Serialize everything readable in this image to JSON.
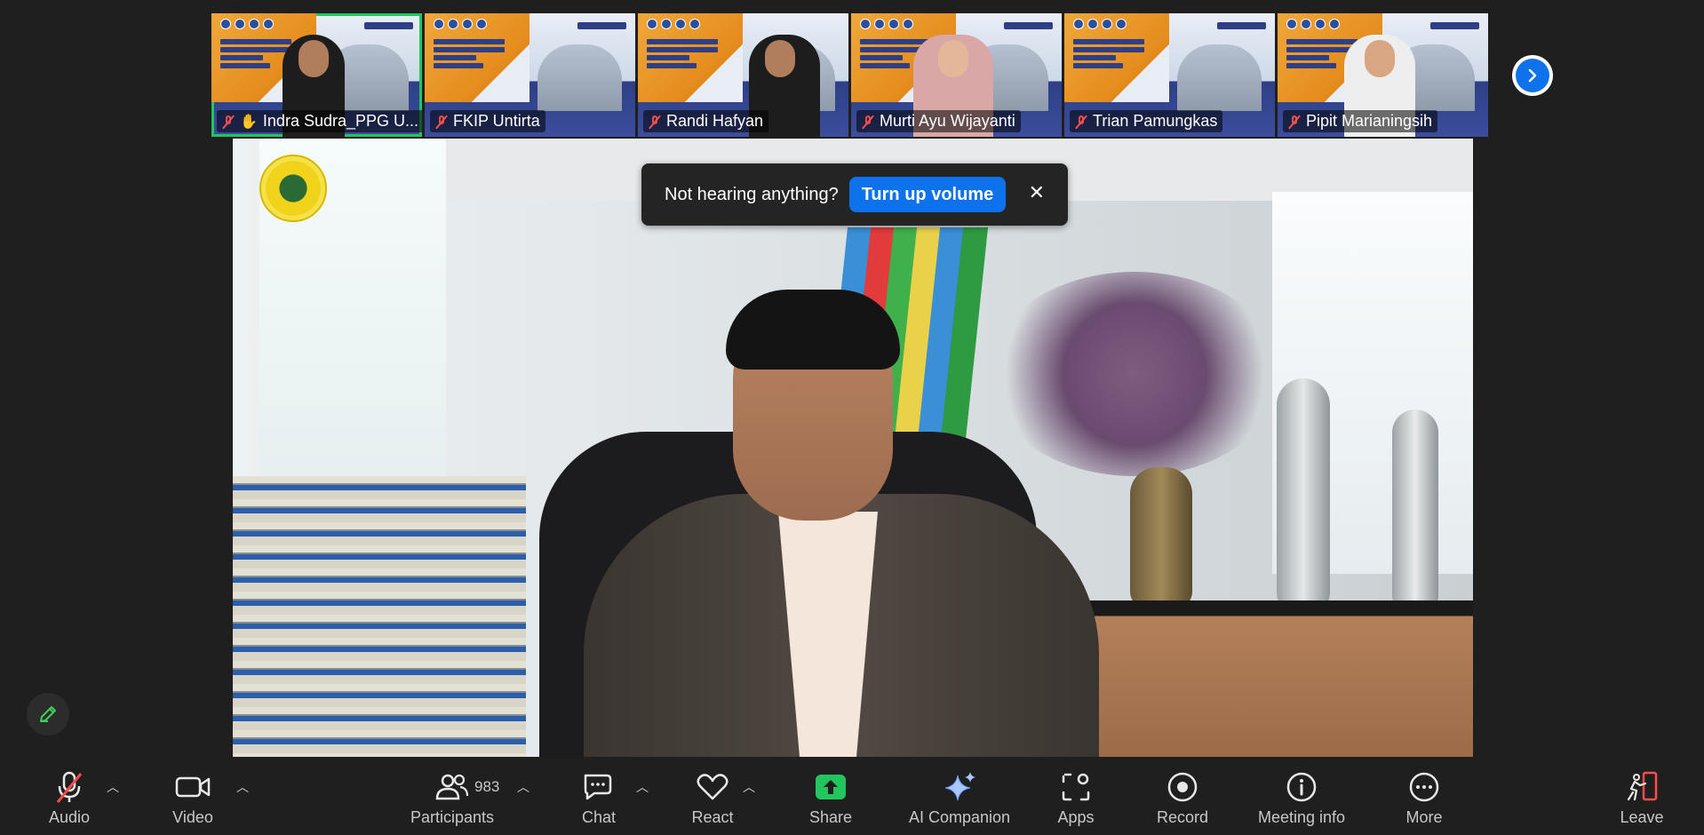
{
  "participants_strip": [
    {
      "name": "Indra Sudra_PPG U...",
      "active": true,
      "raised_hand": true
    },
    {
      "name": "FKIP Untirta",
      "active": false
    },
    {
      "name": "Randi Hafyan",
      "active": false
    },
    {
      "name": "Murti Ayu Wijayanti",
      "active": false
    },
    {
      "name": "Trian Pamungkas",
      "active": false
    },
    {
      "name": "Pipit Marianingsih",
      "active": false
    }
  ],
  "toast": {
    "message": "Not hearing anything?",
    "action": "Turn up volume",
    "close": "✕"
  },
  "toolbar": {
    "audio": "Audio",
    "video": "Video",
    "participants": "Participants",
    "participants_count": "983",
    "chat": "Chat",
    "react": "React",
    "share": "Share",
    "ai_companion": "AI Companion",
    "apps": "Apps",
    "record": "Record",
    "meeting_info": "Meeting info",
    "more": "More",
    "leave": "Leave"
  },
  "colors": {
    "accent": "#0e72ed",
    "active_border": "#22c55e",
    "muted_red": "#ff4d4d",
    "share_green": "#22c55e",
    "toolbar_bg": "#1f1f1f"
  }
}
